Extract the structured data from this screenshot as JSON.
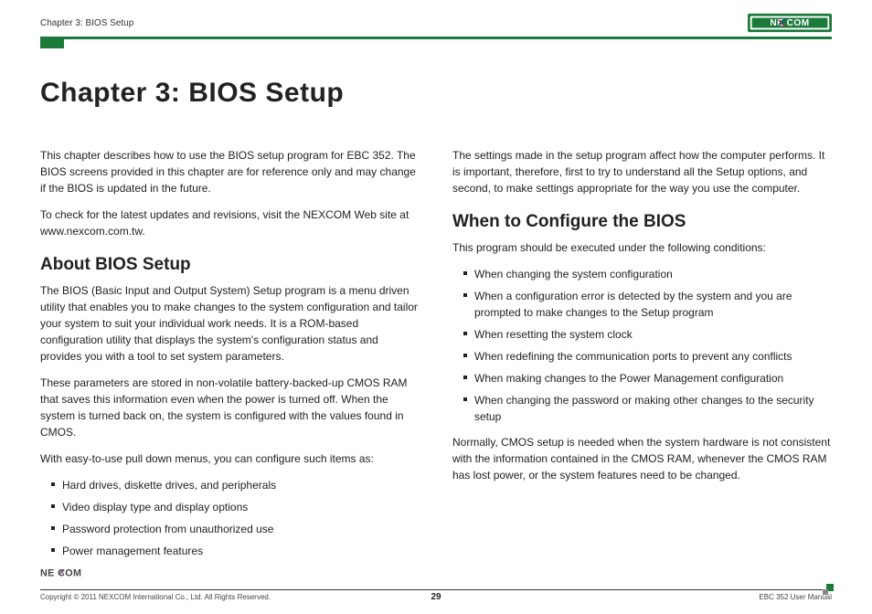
{
  "header": {
    "chapter_label": "Chapter 3: BIOS Setup",
    "logo_text": "NEXCOM"
  },
  "title_line": "Chapter 3: BIOS Setup",
  "left": {
    "intro1": "This chapter describes how to use the BIOS setup program for EBC 352. The BIOS screens provided in this chapter are for reference only and may change if the BIOS is updated in the future.",
    "intro2": "To check for the latest updates and revisions, visit the NEXCOM Web site at www.nexcom.com.tw.",
    "h_about": "About BIOS Setup",
    "about1": "The BIOS (Basic Input and Output System) Setup program is a menu driven utility that enables you to make changes to the system configuration and tailor your system to suit your individual work needs. It is a ROM-based configuration utility that displays the system's configuration status and provides you with a tool to set system parameters.",
    "about2": "These parameters are stored in non-volatile battery-backed-up CMOS RAM that saves this information even when the power is turned off. When the system is turned back on, the system is configured with the values found in CMOS.",
    "about3": "With easy-to-use pull down menus, you can configure such items as:",
    "about_items": [
      "Hard drives, diskette drives, and peripherals",
      "Video display type and display options",
      "Password protection from unauthorized use",
      "Power management features"
    ]
  },
  "right": {
    "intro": "The settings made in the setup program affect how the computer performs. It is important, therefore, first to try to understand all the Setup options, and second, to make settings appropriate for the way you use the computer.",
    "h_when": "When to Configure the BIOS",
    "when_lead": "This program should be executed under the following conditions:",
    "when_items": [
      "When changing the system configuration",
      "When a configuration error is detected by the system and you are prompted to make changes to the Setup program",
      "When resetting the system clock",
      "When redefining the communication ports to prevent any conflicts",
      "When making changes to the Power Management configuration",
      "When changing the password or making other changes to the security setup"
    ],
    "when_tail": "Normally, CMOS setup is needed when the system hardware is not consistent with the information contained in the CMOS RAM, whenever the CMOS RAM has lost power, or the system features need to be changed."
  },
  "footer": {
    "copyright": "Copyright © 2011 NEXCOM International Co., Ltd. All Rights Reserved.",
    "page": "29",
    "manual": "EBC 352 User Manual"
  }
}
